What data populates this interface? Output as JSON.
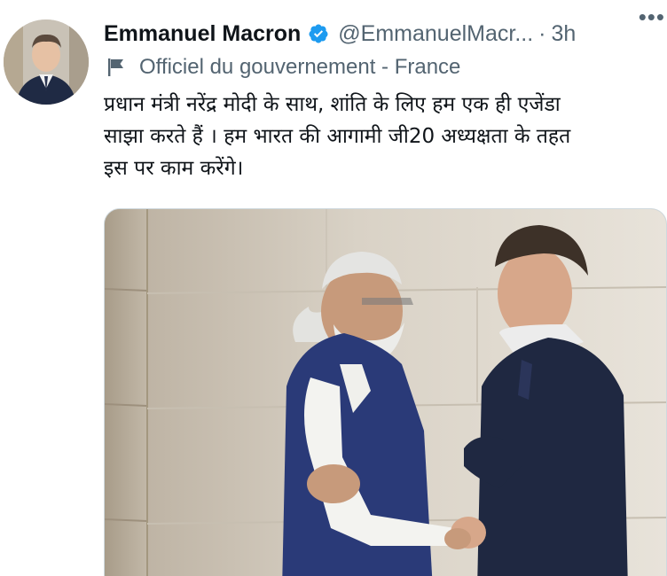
{
  "tweet": {
    "author": {
      "display_name": "Emmanuel Macron",
      "handle": "@EmmanuelMacr...",
      "verified": true,
      "avatar_icon": "profile-photo"
    },
    "separator": "·",
    "time": "3h",
    "more_icon": "more-horizontal-icon",
    "more_label": "•••",
    "government_label": "Officiel du gouvernement - France",
    "government_icon": "flag-icon",
    "lines": [
      "प्रधान मंत्री नरेंद्र मोदी के साथ, शांति के लिए हम एक ही एजेंडा",
      "साझा करते हैं । हम भारत की आगामी जी20 अध्यक्षता के तहत",
      "इस पर काम करेंगे।"
    ],
    "media": {
      "type": "photo",
      "icon": "photo-two-leaders-handshake"
    }
  },
  "colors": {
    "verified": "#1d9bf0",
    "secondary_text": "#536471",
    "primary_text": "#0f1419"
  }
}
